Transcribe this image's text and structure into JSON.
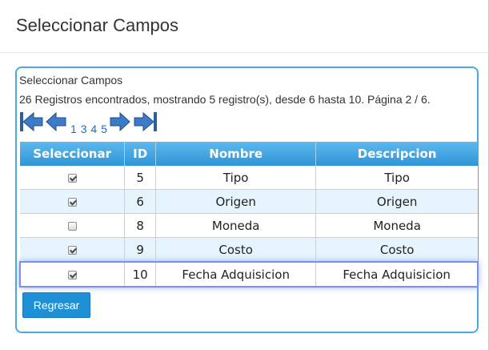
{
  "modal": {
    "title": "Seleccionar Campos"
  },
  "panel": {
    "title": "Seleccionar Campos",
    "records_info": "26 Registros encontrados, mostrando 5 registro(s), desde 6 hasta 10. Página 2 / 6."
  },
  "pager": {
    "icons": [
      "first-page-icon",
      "prev-page-icon",
      "next-page-icon",
      "last-page-icon"
    ],
    "pages": [
      "1",
      "3",
      "4",
      "5"
    ]
  },
  "table": {
    "headers": {
      "select": "Seleccionar",
      "id": "ID",
      "name": "Nombre",
      "description": "Descripcion"
    },
    "rows": [
      {
        "checked": true,
        "id": "5",
        "name": "Tipo",
        "description": "Tipo"
      },
      {
        "checked": true,
        "id": "6",
        "name": "Origen",
        "description": "Origen"
      },
      {
        "checked": false,
        "id": "8",
        "name": "Moneda",
        "description": "Moneda"
      },
      {
        "checked": true,
        "id": "9",
        "name": "Costo",
        "description": "Costo"
      },
      {
        "checked": true,
        "id": "10",
        "name": "Fecha Adquisicion",
        "description": "Fecha Adquisicion"
      }
    ]
  },
  "buttons": {
    "back_label": "Regresar"
  },
  "colors": {
    "accent": "#1e90d6",
    "header": "#2e95d6",
    "alt_row": "#e6f5fd",
    "highlight": "#7a8ff5"
  }
}
